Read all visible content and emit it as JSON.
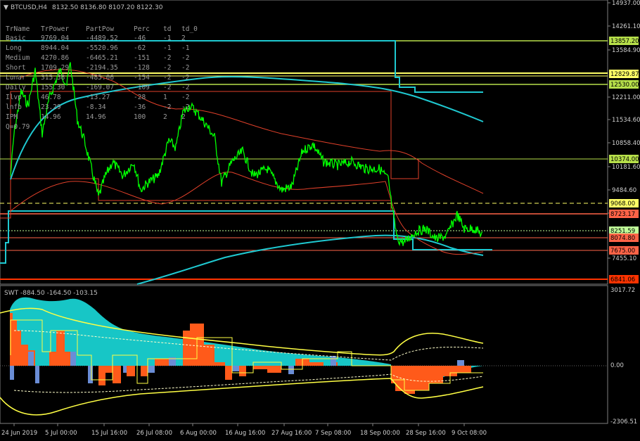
{
  "header": {
    "symbol": "BTCUSD,H4",
    "ohlc": "8132.50 8136.80 8107.20 8122.30",
    "triangle": "▼"
  },
  "stats_table": {
    "headers": [
      "TrName",
      "TrPower",
      "PartPow",
      "Perc",
      "td",
      "td_0"
    ],
    "rows": [
      [
        "Basic",
        "9769.04",
        "-4489.52",
        "-46",
        "-1",
        "2"
      ],
      [
        "Long",
        "8944.04",
        "-5520.96",
        "-62",
        "-1",
        "-1"
      ],
      [
        "Medium",
        "4270.86",
        "-6465.21",
        "-151",
        "-2",
        "-2"
      ],
      [
        "Short",
        "1709.29",
        "-2194.35",
        "-128",
        "-2",
        "-2"
      ],
      [
        "Lunar",
        "315.38",
        "-485.06",
        "-154",
        "-2",
        "-2"
      ],
      [
        "Daily",
        "155.30",
        "-169.07",
        "-109",
        "-2",
        "-2"
      ],
      [
        "Ilvp",
        "46.78",
        "-13.27",
        "-28",
        "1",
        "-2"
      ],
      [
        "lnfb",
        "23.29",
        "-8.34",
        "-36",
        "-2",
        "-2"
      ],
      [
        "IPM",
        "14.96",
        "14.96",
        "100",
        "2",
        "2"
      ]
    ],
    "footer": "Q=0.79"
  },
  "price_axis": {
    "ticks": [
      "14937.00",
      "14261.10",
      "13584.90",
      "12211.00",
      "11534.60",
      "10858.40",
      "10181.60",
      "9484.60",
      "8808.60",
      "7455.10"
    ]
  },
  "price_levels": [
    {
      "label": "13857.20",
      "color": "#b7e04a"
    },
    {
      "label": "12829.87",
      "color": "#ffff66"
    },
    {
      "label": "12530.00",
      "color": "#b7e04a"
    },
    {
      "label": "10374.00",
      "color": "#b7e04a"
    },
    {
      "label": "9068.00",
      "color": "#ffff66"
    },
    {
      "label": "8723.17",
      "color": "#ff6347"
    },
    {
      "label": "8251.59",
      "color": "#c0ff99"
    },
    {
      "label": "8074.80",
      "color": "#ff6347"
    },
    {
      "label": "7675.00",
      "color": "#ff6347"
    },
    {
      "label": "6841.06",
      "color": "#ff3300"
    }
  ],
  "oscillator": {
    "label": "SWT -884.50 -164.50 -103.15",
    "ticks": [
      "3017.72",
      "0.00",
      "-2306.51"
    ]
  },
  "time_axis": {
    "labels": [
      "24 Jun 2019",
      "5 Jul 00:00",
      "15 Jul 16:00",
      "26 Jul 08:00",
      "6 Aug 00:00",
      "16 Aug 16:00",
      "27 Aug 16:00",
      "7 Sep 08:00",
      "18 Sep 00:00",
      "28 Sep 16:00",
      "9 Oct 08:00"
    ]
  },
  "colors": {
    "price_line": "#00ff00",
    "cyan_ma": "#1fc9d1",
    "red_band": "#e0402a",
    "grid": "#2a2a2a",
    "axis": "#808080"
  }
}
